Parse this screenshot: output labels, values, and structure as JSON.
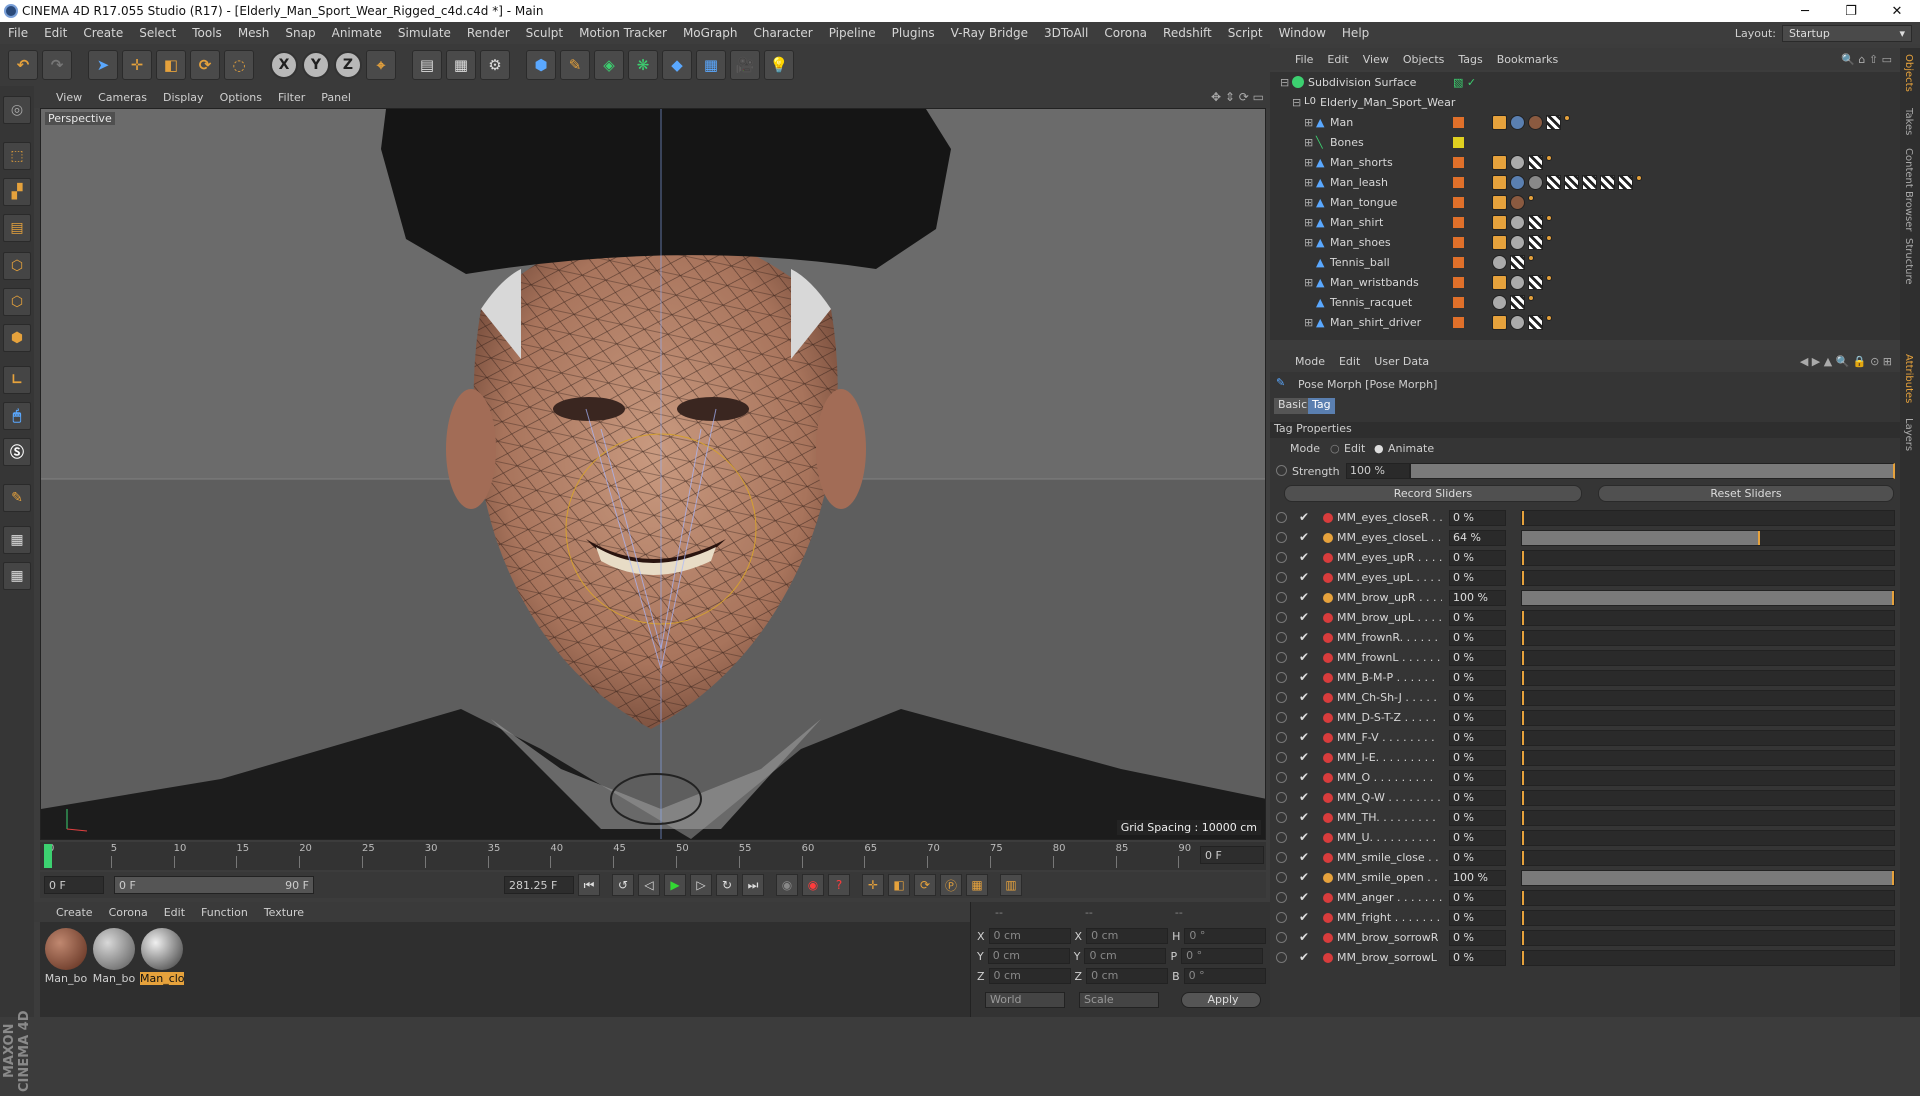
{
  "window": {
    "title": "CINEMA 4D R17.055 Studio (R17) - [Elderly_Man_Sport_Wear_Rigged_c4d.c4d *] - Main",
    "buttons": [
      "─",
      "❐",
      "✕"
    ]
  },
  "menubar": {
    "items": [
      "File",
      "Edit",
      "Create",
      "Select",
      "Tools",
      "Mesh",
      "Snap",
      "Animate",
      "Simulate",
      "Render",
      "Sculpt",
      "Motion Tracker",
      "MoGraph",
      "Character",
      "Pipeline",
      "Plugins",
      "V-Ray Bridge",
      "3DToAll",
      "Corona",
      "Redshift",
      "Script",
      "Window",
      "Help"
    ],
    "layout_label": "Layout:",
    "layout_value": "Startup"
  },
  "viewport": {
    "menu": [
      "View",
      "Cameras",
      "Display",
      "Options",
      "Filter",
      "Panel"
    ],
    "label": "Perspective",
    "grid_spacing": "Grid Spacing : 10000 cm"
  },
  "timeline": {
    "ticks": [
      "0",
      "5",
      "10",
      "15",
      "20",
      "25",
      "30",
      "35",
      "40",
      "45",
      "50",
      "55",
      "60",
      "65",
      "70",
      "75",
      "80",
      "85",
      "90"
    ],
    "current_frame": "0 F",
    "start_frame": "0 F",
    "range_start": "0 F",
    "range_end": "90 F",
    "fps_field": "281.25 F"
  },
  "materials": {
    "menu": [
      "Create",
      "Corona",
      "Edit",
      "Function",
      "Texture"
    ],
    "items": [
      "Man_bo",
      "Man_bo",
      "Man_clo"
    ]
  },
  "coords": {
    "headers": [
      "--",
      "--",
      "--"
    ],
    "rows": [
      {
        "a": "X",
        "av": "0 cm",
        "b": "X",
        "bv": "0 cm",
        "c": "H",
        "cv": "0 °"
      },
      {
        "a": "Y",
        "av": "0 cm",
        "b": "Y",
        "bv": "0 cm",
        "c": "P",
        "cv": "0 °"
      },
      {
        "a": "Z",
        "av": "0 cm",
        "b": "Z",
        "bv": "0 cm",
        "c": "B",
        "cv": "0 °"
      }
    ],
    "world": "World",
    "scale": "Scale",
    "apply": "Apply"
  },
  "objects": {
    "menu": [
      "File",
      "Edit",
      "View",
      "Objects",
      "Tags",
      "Bookmarks"
    ],
    "rows": [
      {
        "name": "Subdivision Surface",
        "layer": ""
      },
      {
        "name": "Elderly_Man_Sport_Wear",
        "layer": ""
      },
      {
        "name": "Man",
        "layer": "#e0702a"
      },
      {
        "name": "Bones",
        "layer": "#e0d020"
      },
      {
        "name": "Man_shorts",
        "layer": "#e0702a"
      },
      {
        "name": "Man_leash",
        "layer": "#e0702a"
      },
      {
        "name": "Man_tongue",
        "layer": "#e0702a"
      },
      {
        "name": "Man_shirt",
        "layer": "#e0702a"
      },
      {
        "name": "Man_shoes",
        "layer": "#e0702a"
      },
      {
        "name": "Tennis_ball",
        "layer": "#e0702a"
      },
      {
        "name": "Man_wristbands",
        "layer": "#e0702a"
      },
      {
        "name": "Tennis_racquet",
        "layer": "#e0702a"
      },
      {
        "name": "Man_shirt_driver",
        "layer": "#e0702a"
      }
    ]
  },
  "attributes": {
    "menu": [
      "Mode",
      "Edit",
      "User Data"
    ],
    "title": "Pose Morph [Pose Morph]",
    "tabs": [
      "Basic",
      "Tag"
    ],
    "section": "Tag Properties",
    "mode_label": "Mode",
    "mode_edit": "Edit",
    "mode_animate": "Animate",
    "strength_label": "Strength",
    "strength_value": "100 %",
    "record_sliders": "Record Sliders",
    "reset_sliders": "Reset Sliders",
    "sliders": [
      {
        "name": "MM_eyes_closeR . . .",
        "value": "0 %",
        "level": 0
      },
      {
        "name": "MM_eyes_closeL . . .",
        "value": "64 %",
        "level": 0.64
      },
      {
        "name": "MM_eyes_upR . . . . .",
        "value": "0 %",
        "level": 0
      },
      {
        "name": "MM_eyes_upL . . . . .",
        "value": "0 %",
        "level": 0
      },
      {
        "name": "MM_brow_upR . . . .",
        "value": "100 %",
        "level": 1
      },
      {
        "name": "MM_brow_upL . . . .",
        "value": "0 %",
        "level": 0
      },
      {
        "name": "MM_frownR. . . . . .",
        "value": "0 %",
        "level": 0
      },
      {
        "name": "MM_frownL . . . . . .",
        "value": "0 %",
        "level": 0
      },
      {
        "name": "MM_B-M-P . . . . . .",
        "value": "0 %",
        "level": 0
      },
      {
        "name": "MM_Ch-Sh-J . . . . .",
        "value": "0 %",
        "level": 0
      },
      {
        "name": "MM_D-S-T-Z . . . . .",
        "value": "0 %",
        "level": 0
      },
      {
        "name": "MM_F-V . . . . . . . .",
        "value": "0 %",
        "level": 0
      },
      {
        "name": "MM_I-E. . . . . . . . .",
        "value": "0 %",
        "level": 0
      },
      {
        "name": "MM_O . . . . . . . . .",
        "value": "0 %",
        "level": 0
      },
      {
        "name": "MM_Q-W . . . . . . . .",
        "value": "0 %",
        "level": 0
      },
      {
        "name": "MM_TH. . . . . . . . .",
        "value": "0 %",
        "level": 0
      },
      {
        "name": "MM_U. . . . . . . . . .",
        "value": "0 %",
        "level": 0
      },
      {
        "name": "MM_smile_close . . .",
        "value": "0 %",
        "level": 0
      },
      {
        "name": "MM_smile_open . . .",
        "value": "100 %",
        "level": 1
      },
      {
        "name": "MM_anger . . . . . . .",
        "value": "0 %",
        "level": 0
      },
      {
        "name": "MM_fright . . . . . . .",
        "value": "0 %",
        "level": 0
      },
      {
        "name": "MM_brow_sorrowR",
        "value": "0 %",
        "level": 0
      },
      {
        "name": "MM_brow_sorrowL",
        "value": "0 %",
        "level": 0
      }
    ]
  },
  "side_tabs": [
    "Objects",
    "Takes",
    "Content Browser",
    "Structure",
    "Attributes",
    "Layers"
  ]
}
